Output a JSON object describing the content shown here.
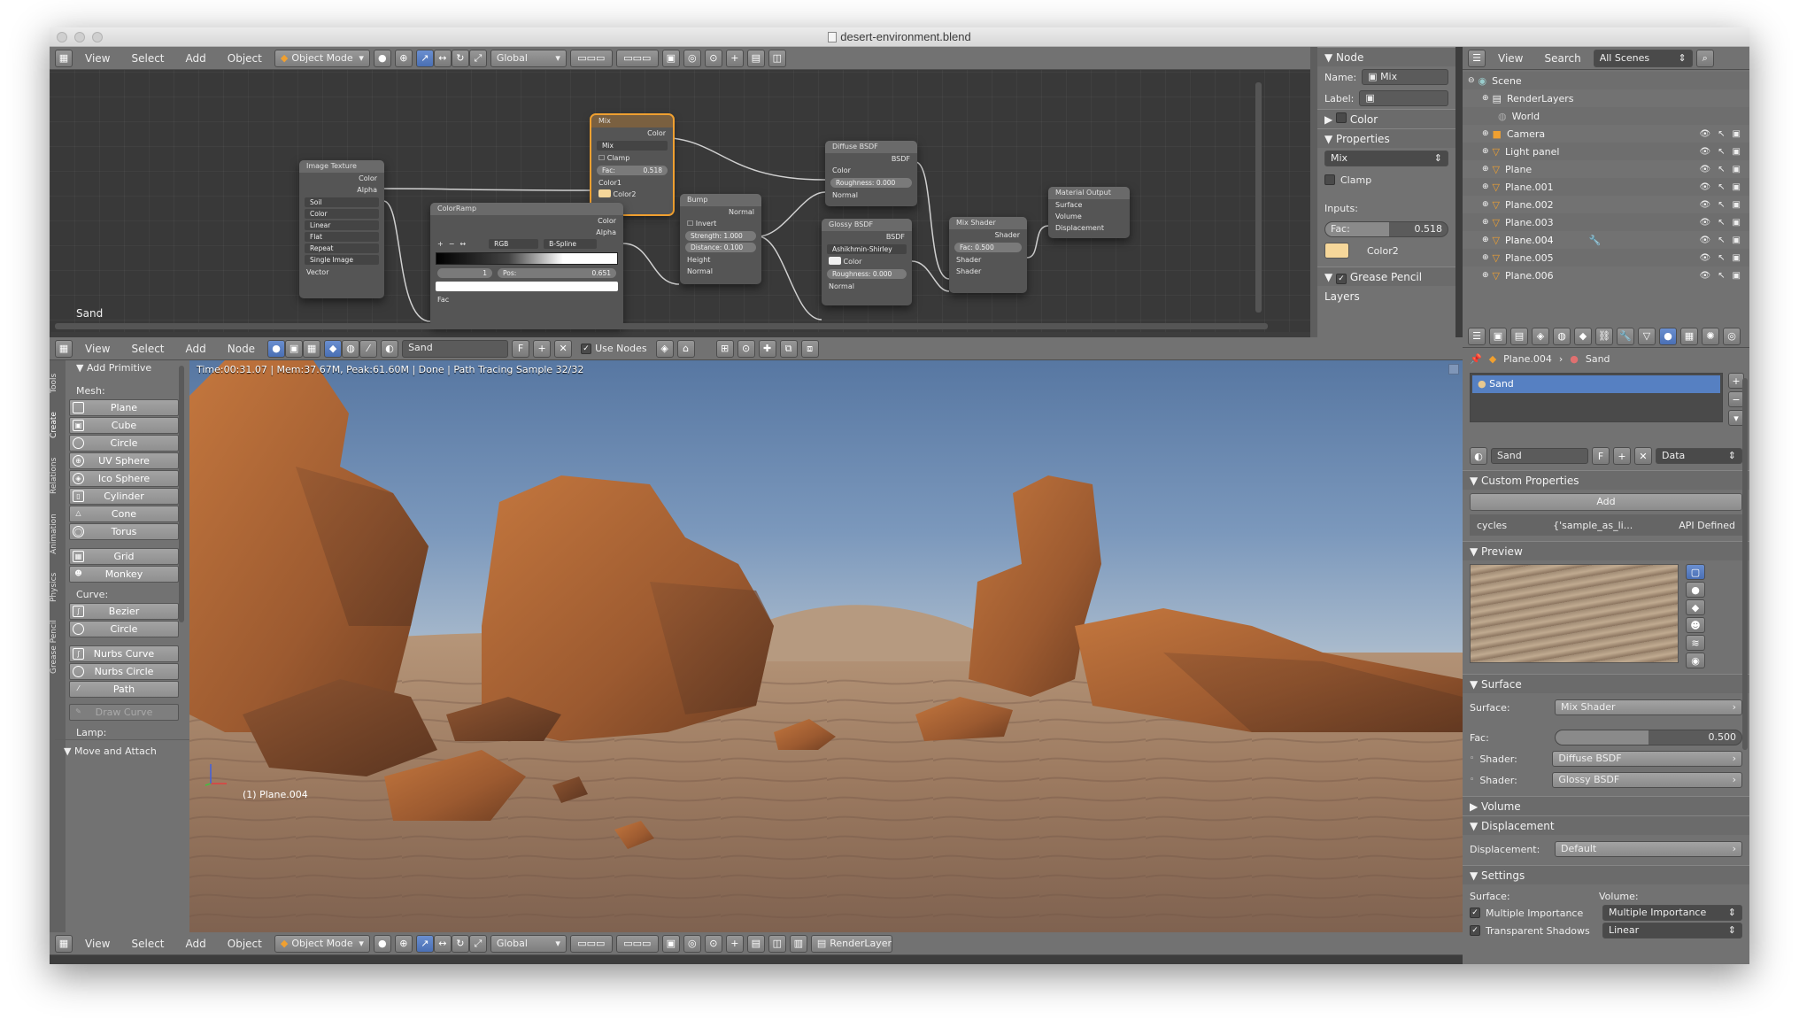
{
  "window": {
    "title": "desert-environment.blend"
  },
  "node_editor": {
    "header": {
      "menus": [
        "View",
        "Select",
        "Add",
        "Object"
      ],
      "mode": "Object Mode",
      "orientation": "Global"
    },
    "label": "Sand",
    "nodes": {
      "image_texture": {
        "title": "Image Texture",
        "out_color": "Color",
        "out_alpha": "Alpha",
        "dd1": "Color",
        "dd2": "Linear",
        "dd3": "Flat",
        "dd4": "Repeat",
        "dd5": "Single Image",
        "in_vector": "Vector",
        "img_name": "Soil"
      },
      "mix": {
        "title": "Mix",
        "out_color": "Color",
        "mode": "Mix",
        "clamp": "Clamp",
        "fac_label": "Fac:",
        "fac_value": "0.518",
        "color1": "Color1",
        "color2": "Color2"
      },
      "colorramp": {
        "title": "ColorRamp",
        "out_color": "Color",
        "out_alpha": "Alpha",
        "mode": "RGB",
        "interp": "B-Spline",
        "index": "1",
        "pos_label": "Pos:",
        "pos_value": "0.651",
        "in_fac": "Fac"
      },
      "bump": {
        "title": "Bump",
        "out_normal": "Normal",
        "invert": "Invert",
        "strength": "Strength: 1.000",
        "distance": "Distance: 0.100",
        "height": "Height",
        "normal": "Normal"
      },
      "diffuse": {
        "title": "Diffuse BSDF",
        "out_bsdf": "BSDF",
        "color": "Color",
        "roughness": "Roughness: 0.000",
        "normal": "Normal"
      },
      "glossy": {
        "title": "Glossy BSDF",
        "out_bsdf": "BSDF",
        "dist": "Ashikhmin-Shirley",
        "color": "Color",
        "roughness": "Roughness: 0.000",
        "normal": "Normal"
      },
      "mix_shader": {
        "title": "Mix Shader",
        "out_shader": "Shader",
        "fac": "Fac: 0.500",
        "shader1": "Shader",
        "shader2": "Shader"
      },
      "output": {
        "title": "Material Output",
        "surface": "Surface",
        "volume": "Volume",
        "displacement": "Displacement"
      }
    }
  },
  "node_props": {
    "node_heading": "Node",
    "name_label": "Name:",
    "name_value": "Mix",
    "label_label": "Label:",
    "color_heading": "Color",
    "properties_heading": "Properties",
    "blend_mode": "Mix",
    "clamp_label": "Clamp",
    "inputs_label": "Inputs:",
    "fac_label": "Fac:",
    "fac_value": "0.518",
    "color2_label": "Color2",
    "color2_swatch": "#f6d79a",
    "grease_heading": "Grease Pencil Layers"
  },
  "outliner": {
    "menus": [
      "View",
      "Search"
    ],
    "scene_select": "All Scenes",
    "items": [
      "Scene",
      "RenderLayers",
      "World",
      "Camera",
      "Light panel",
      "Plane",
      "Plane.001",
      "Plane.002",
      "Plane.003",
      "Plane.004",
      "Plane.005",
      "Plane.006"
    ]
  },
  "node_header": {
    "menus": [
      "View",
      "Select",
      "Add",
      "Node"
    ],
    "material": "Sand",
    "fake_user": "F",
    "use_nodes": "Use Nodes"
  },
  "tool_shelf": {
    "tabs": [
      "Tools",
      "Create",
      "Relations",
      "Animation",
      "Physics",
      "Grease Pencil"
    ],
    "add_primitive": "Add Primitive",
    "mesh_label": "Mesh:",
    "mesh": [
      "Plane",
      "Cube",
      "Circle",
      "UV Sphere",
      "Ico Sphere",
      "Cylinder",
      "Cone",
      "Torus"
    ],
    "mesh2": [
      "Grid",
      "Monkey"
    ],
    "curve_label": "Curve:",
    "curve": [
      "Bezier",
      "Circle"
    ],
    "curve2": [
      "Nurbs Curve",
      "Nurbs Circle",
      "Path"
    ],
    "draw_curve": "Draw Curve",
    "lamp_label": "Lamp:",
    "move_attach": "Move and Attach"
  },
  "viewport": {
    "status": "Time:00:31.07 | Mem:37.67M, Peak:61.60M | Done | Path Tracing Sample 32/32",
    "object_label": "(1) Plane.004"
  },
  "bottom_header": {
    "menus": [
      "View",
      "Select",
      "Add",
      "Object"
    ],
    "mode": "Object Mode",
    "orientation": "Global",
    "render_layer": "RenderLayer"
  },
  "properties": {
    "breadcrumb_obj": "Plane.004",
    "breadcrumb_mat": "Sand",
    "slot": "Sand",
    "material_name": "Sand",
    "fake_user": "F",
    "link": "Data",
    "custom_props_heading": "Custom Properties",
    "add_button": "Add",
    "prop_key": "cycles",
    "prop_val": "{'sample_as_li...",
    "prop_note": "API Defined",
    "preview_heading": "Preview",
    "surface_heading": "Surface",
    "surface_label": "Surface:",
    "surface_value": "Mix Shader",
    "fac_label": "Fac:",
    "fac_value": "0.500",
    "fac_fraction": 0.5,
    "shader1_label": "Shader:",
    "shader1_value": "Diffuse BSDF",
    "shader2_label": "Shader:",
    "shader2_value": "Glossy BSDF",
    "volume_heading": "Volume",
    "displacement_heading": "Displacement",
    "displacement_label": "Displacement:",
    "displacement_value": "Default",
    "settings_heading": "Settings",
    "settings_surface_label": "Surface:",
    "settings_volume_label": "Volume:",
    "mi_surface": "Multiple Importance",
    "mi_volume": "Multiple Importance",
    "transparent_shadows": "Transparent Shadows",
    "linear": "Linear"
  }
}
